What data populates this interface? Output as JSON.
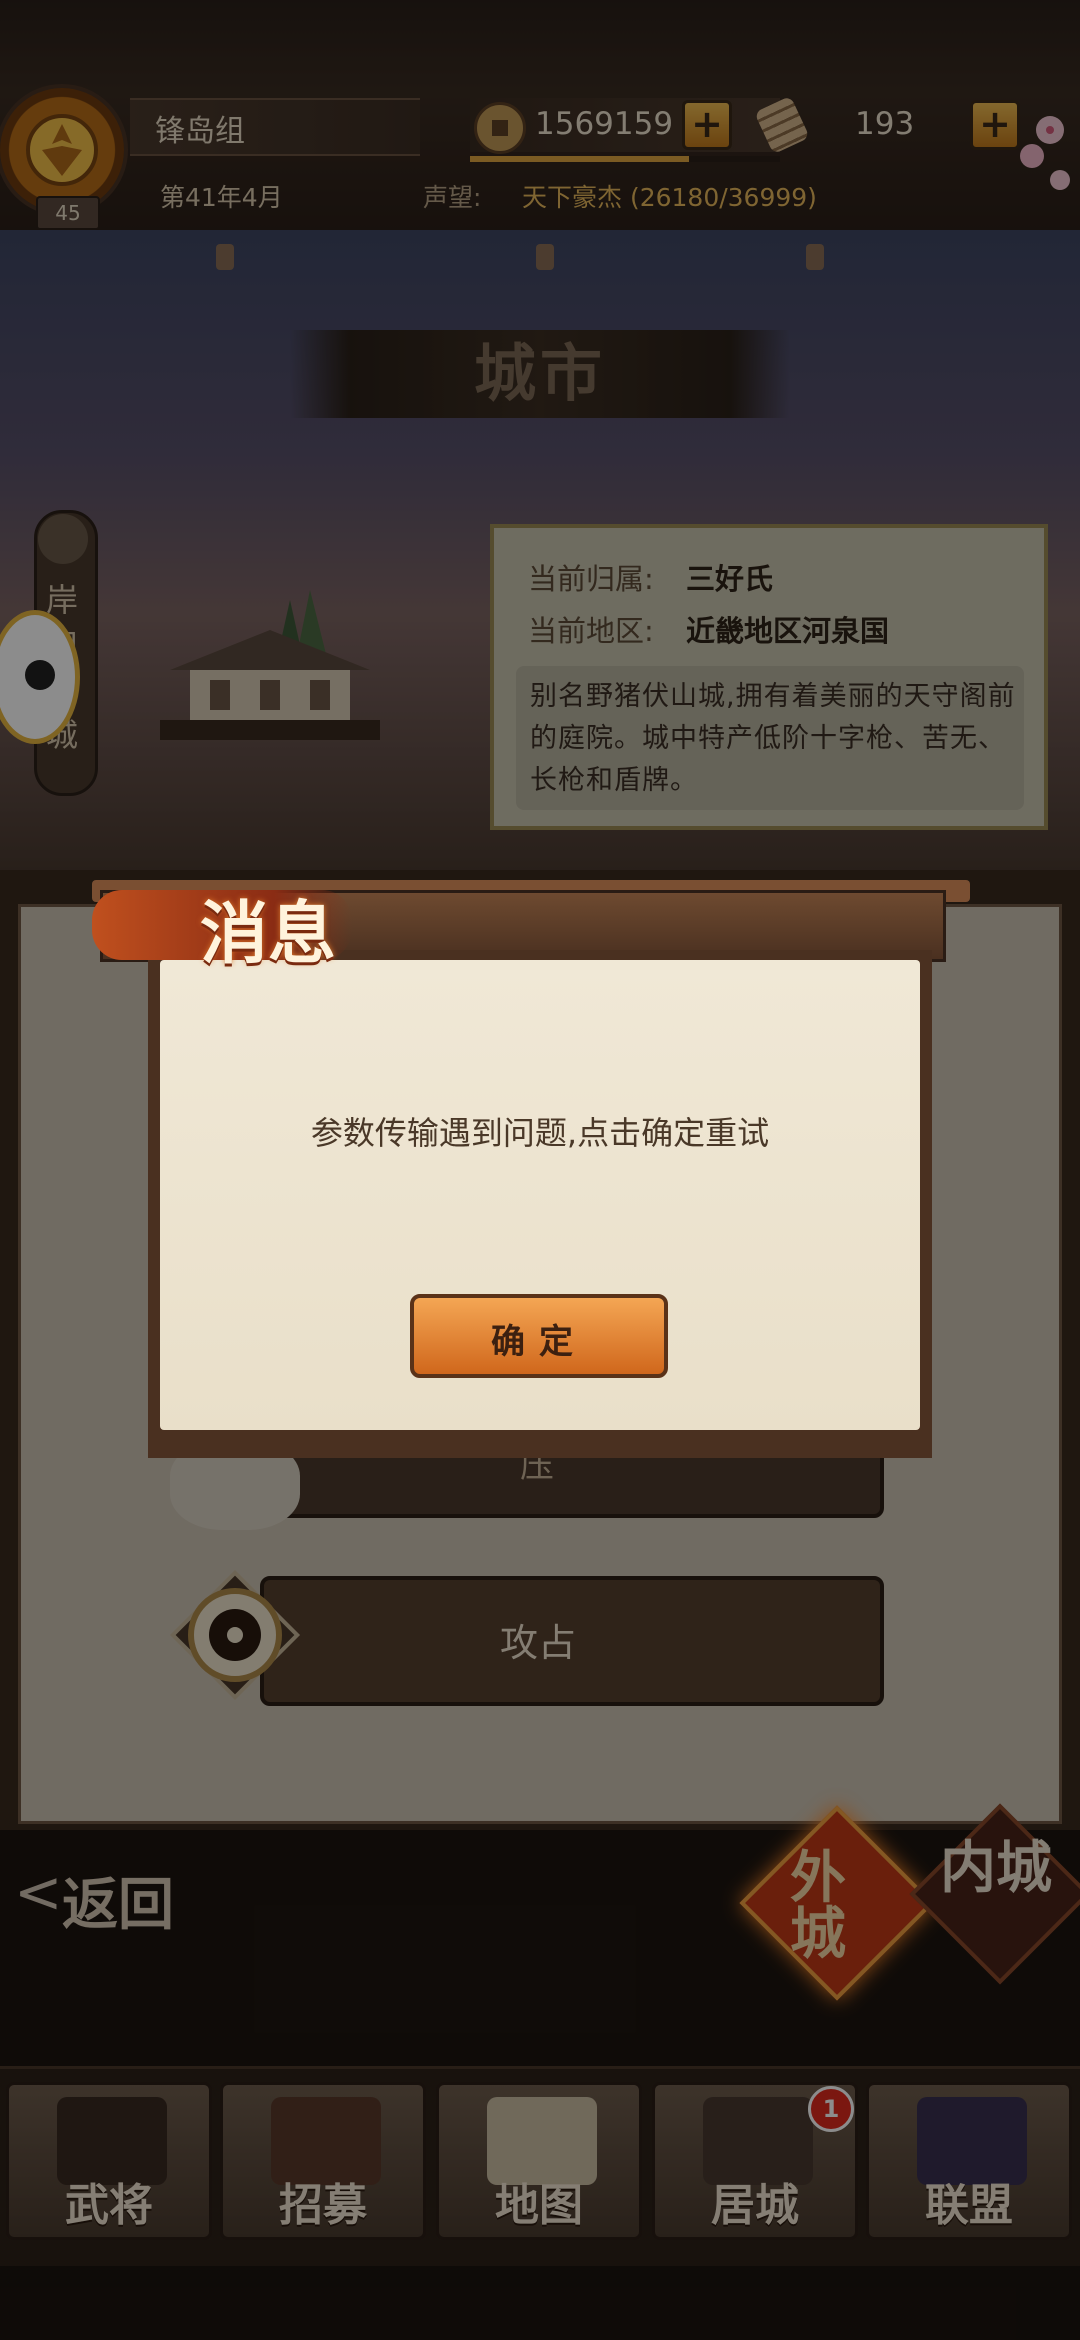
{
  "header": {
    "clan_name": "锋岛组",
    "level": "45",
    "coins": "1569159",
    "scrolls": "193",
    "date": "第41年4月",
    "fame_label": "声望:",
    "fame_value": "天下豪杰 (26180/36999)",
    "fame_progress": 0.708
  },
  "scene": {
    "title": "城市",
    "castle_tab": "岸和田城"
  },
  "info": {
    "owner_label": "当前归属:",
    "owner_value": "三好氏",
    "region_label": "当前地区:",
    "region_value": "近畿地区河泉国",
    "description": "别名野猪伏山城,拥有着美丽的天守阁前的庭院。城中特产低阶十字枪、苦无、长枪和盾牌。"
  },
  "actions": {
    "row1_label": "压",
    "attack_label": "攻占"
  },
  "dialog": {
    "title": "消息",
    "message": "参数传输遇到问题,点击确定重试",
    "confirm": "确定"
  },
  "controls": {
    "back": "返回",
    "back_arrow": "<",
    "tab_outer": "外城",
    "tab_inner": "内城"
  },
  "nav": {
    "items": [
      {
        "label": "武将",
        "icon": "samurai-helmet-icon"
      },
      {
        "label": "招募",
        "icon": "recruit-gate-icon"
      },
      {
        "label": "地图",
        "icon": "map-scroll-icon"
      },
      {
        "label": "居城",
        "icon": "castle-icon"
      },
      {
        "label": "联盟",
        "icon": "alliance-banner-icon"
      }
    ],
    "badge_count": "1"
  },
  "colors": {
    "accent": "#d0671c",
    "badge": "#e02a1e",
    "gold": "#e7b85c"
  }
}
